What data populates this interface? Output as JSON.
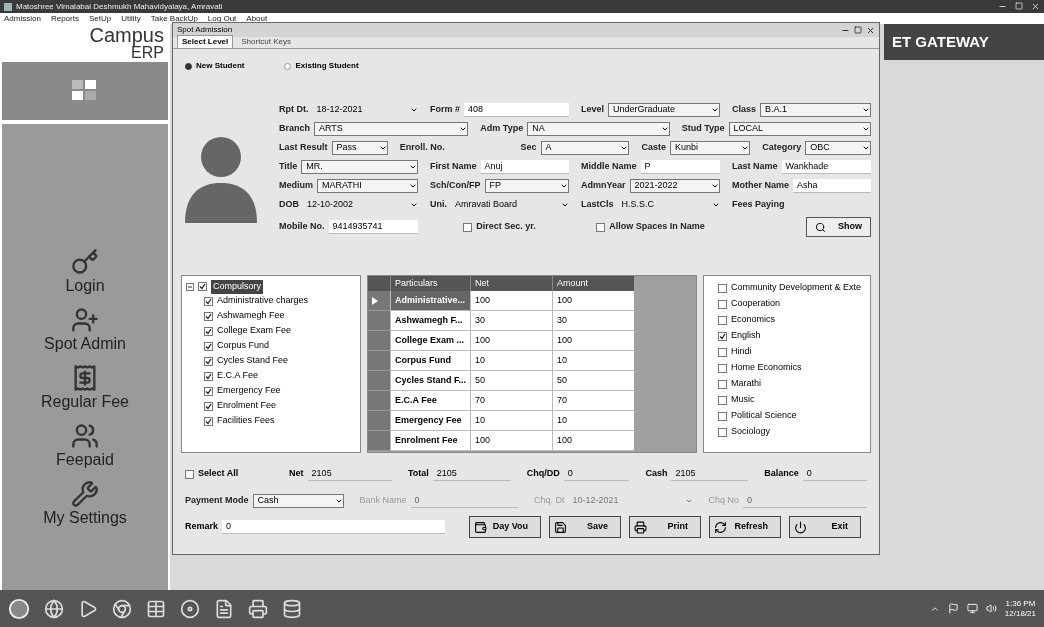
{
  "app": {
    "title": "Matoshree Vimalabai Deshmukh Mahavidyalaya, Amravati",
    "menu": [
      "Admission",
      "Reports",
      "SetUp",
      "Utility",
      "Take BackUp",
      "Log Out",
      "About"
    ],
    "logo": {
      "name": "Campus",
      "suffix": "ERP"
    },
    "banner": "ET GATEWAY"
  },
  "sidebar": {
    "items": [
      {
        "label": "Login"
      },
      {
        "label": "Spot Admin"
      },
      {
        "label": "Regular Fee"
      },
      {
        "label": "Feepaid"
      },
      {
        "label": "My Settings"
      }
    ]
  },
  "dialog": {
    "title": "Spot Admission",
    "tabs": [
      {
        "label": "Select Level",
        "selected": true
      },
      {
        "label": "Shortcut Keys",
        "selected": false
      }
    ],
    "student_type": [
      {
        "label": "New Student",
        "selected": true
      },
      {
        "label": "Existing Student",
        "selected": false
      }
    ],
    "form_rows": [
      [
        {
          "kind": "date",
          "label": "Rpt Dt.",
          "value": "18-12-2021"
        },
        {
          "kind": "text",
          "label": "Form #",
          "value": "408"
        },
        {
          "kind": "combo",
          "label": "Level",
          "value": "UnderGraduate"
        },
        {
          "kind": "combo",
          "label": "Class",
          "value": "B.A.1"
        }
      ],
      [
        {
          "kind": "combo",
          "label": "Branch",
          "value": "ARTS"
        },
        {
          "kind": "combo",
          "label": "Adm Type",
          "value": "NA"
        },
        {
          "kind": "combo",
          "label": "Stud Type",
          "value": "LOCAL"
        }
      ],
      [
        {
          "kind": "combo",
          "label": "Last Result",
          "value": "Pass"
        },
        {
          "kind": "label",
          "label": "Enroll. No."
        },
        {
          "kind": "combo",
          "label": "Sec",
          "value": "A"
        },
        {
          "kind": "combo",
          "label": "Caste",
          "value": "Kunbi"
        },
        {
          "kind": "combo",
          "label": "Category",
          "value": "OBC"
        }
      ],
      [
        {
          "kind": "combo",
          "label": "Title",
          "value": "MR."
        },
        {
          "kind": "text",
          "label": "First Name",
          "value": "Anuj"
        },
        {
          "kind": "text",
          "label": "Middle Name",
          "value": "P"
        },
        {
          "kind": "text",
          "label": "Last Name",
          "value": "Wankhade"
        }
      ],
      [
        {
          "kind": "combo",
          "label": "Medium",
          "value": "MARATHI"
        },
        {
          "kind": "combo",
          "label": "Sch/Con/FP",
          "value": "FP"
        },
        {
          "kind": "combo",
          "label": "AdmnYear",
          "value": "2021-2022"
        },
        {
          "kind": "text",
          "label": "Mother Name",
          "value": "Asha"
        }
      ],
      [
        {
          "kind": "date",
          "label": "DOB",
          "value": "12-10-2002"
        },
        {
          "kind": "date",
          "label": "Uni.",
          "value": "Amravati Board"
        },
        {
          "kind": "date",
          "label": "LastCls",
          "value": "H.S.S.C"
        },
        {
          "kind": "label",
          "label": "Fees Paying"
        }
      ],
      [
        {
          "kind": "text",
          "label": "Mobile No.",
          "value": "9414935741"
        },
        {
          "kind": "check",
          "label": "Direct Sec. yr.",
          "checked": false
        },
        {
          "kind": "check",
          "label": "Allow Spaces In Name",
          "checked": false
        },
        {
          "kind": "button",
          "label": "Show"
        }
      ]
    ],
    "fee_tree": {
      "label": "Compulsory",
      "checked": true,
      "selected": true,
      "expanded": true,
      "children": [
        {
          "label": "Administrative charges",
          "checked": true
        },
        {
          "label": "Ashwamegh Fee",
          "checked": true
        },
        {
          "label": "College Exam Fee",
          "checked": true
        },
        {
          "label": "Corpus Fund",
          "checked": true
        },
        {
          "label": "Cycles Stand Fee",
          "checked": true
        },
        {
          "label": "E.C.A Fee",
          "checked": true
        },
        {
          "label": "Emergency Fee",
          "checked": true
        },
        {
          "label": "Enrolment Fee",
          "checked": true
        },
        {
          "label": "Facilities Fees",
          "checked": true
        }
      ]
    },
    "fee_table": {
      "columns": [
        "Particulars",
        "Net",
        "Amount"
      ],
      "rows": [
        {
          "cells": [
            "Administrative...",
            "100",
            "100"
          ],
          "selected": true
        },
        {
          "cells": [
            "Ashwamegh F...",
            "30",
            "30"
          ],
          "selected": false
        },
        {
          "cells": [
            "College Exam ...",
            "100",
            "100"
          ],
          "selected": false
        },
        {
          "cells": [
            "Corpus Fund",
            "10",
            "10"
          ],
          "selected": false
        },
        {
          "cells": [
            "Cycles Stand F...",
            "50",
            "50"
          ],
          "selected": false
        },
        {
          "cells": [
            "E.C.A Fee",
            "70",
            "70"
          ],
          "selected": false
        },
        {
          "cells": [
            "Emergency Fee",
            "10",
            "10"
          ],
          "selected": false
        },
        {
          "cells": [
            "Enrolment Fee",
            "100",
            "100"
          ],
          "selected": false
        }
      ]
    },
    "subjects": [
      {
        "label": "Community Development & Exte",
        "checked": false
      },
      {
        "label": "Cooperation",
        "checked": false
      },
      {
        "label": "Economics",
        "checked": false
      },
      {
        "label": "English",
        "checked": true
      },
      {
        "label": "Hindi",
        "checked": false
      },
      {
        "label": "Home Economics",
        "checked": false
      },
      {
        "label": "Marathi",
        "checked": false
      },
      {
        "label": "Music",
        "checked": false
      },
      {
        "label": "Political Science",
        "checked": false
      },
      {
        "label": "Sociology",
        "checked": false
      }
    ],
    "select_all": {
      "label": "Select All",
      "checked": false
    },
    "totals": [
      {
        "label": "Net",
        "value": "2105"
      },
      {
        "label": "Total",
        "value": "2105"
      },
      {
        "label": "Chq/DD",
        "value": "0"
      },
      {
        "label": "Cash",
        "value": "2105"
      },
      {
        "label": "Balance",
        "value": "0"
      }
    ],
    "payment": [
      {
        "kind": "combo",
        "label": "Payment Mode",
        "value": "Cash",
        "disabled": false
      },
      {
        "kind": "text",
        "label": "Bank Name",
        "value": "0",
        "disabled": true
      },
      {
        "kind": "date",
        "label": "Chq. Dt",
        "value": "10-12-2021",
        "disabled": true
      },
      {
        "kind": "text",
        "label": "Chq No",
        "value": "0",
        "disabled": true
      }
    ],
    "remark": {
      "label": "Remark",
      "value": "0"
    },
    "buttons": [
      "Day Vou",
      "Save",
      "Print",
      "Refresh",
      "Exit"
    ]
  },
  "taskbar": {
    "time": "1:36 PM",
    "date": "12/18/21"
  }
}
